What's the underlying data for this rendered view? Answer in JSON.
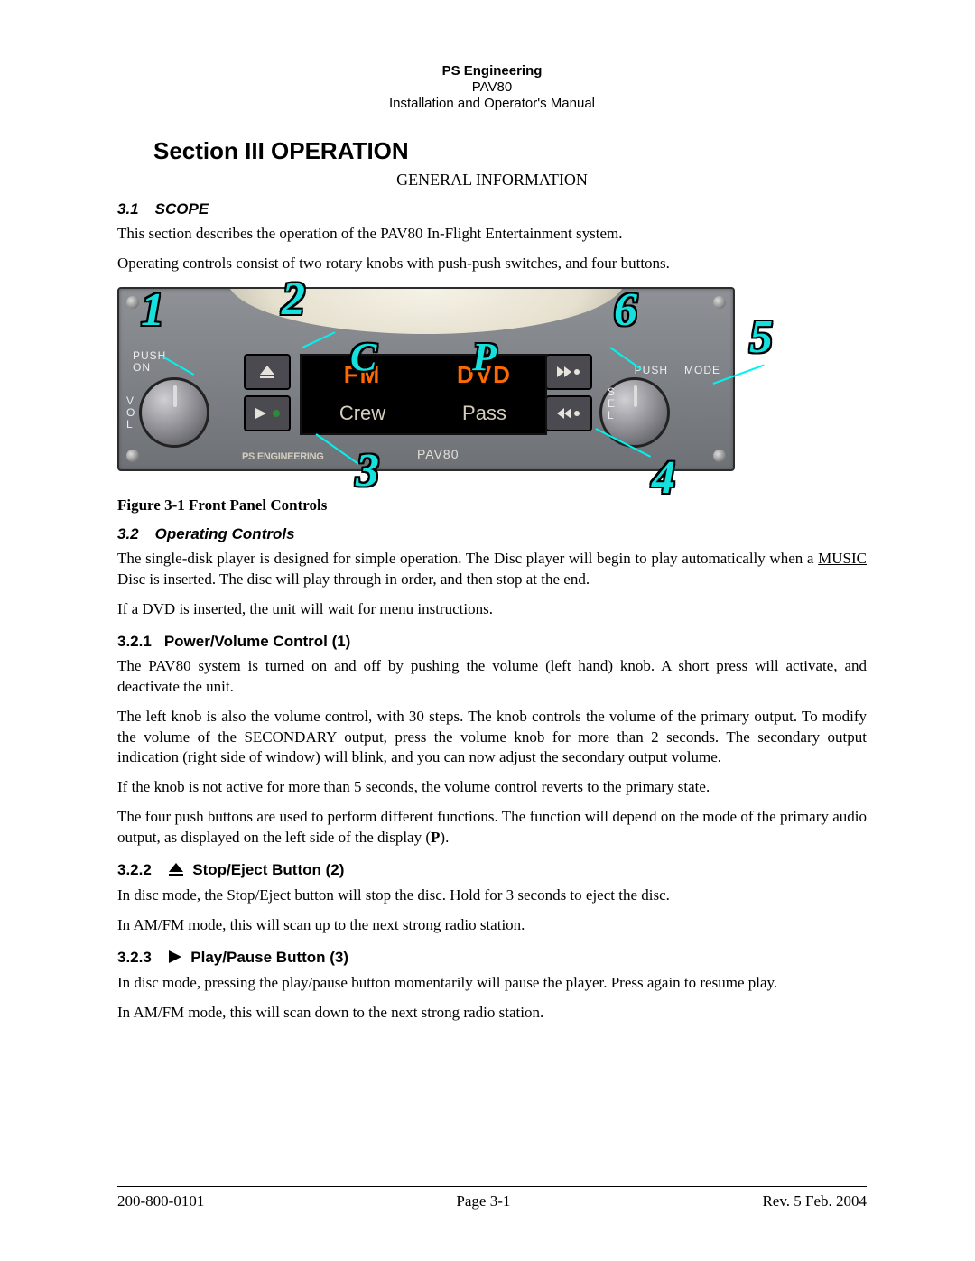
{
  "header": {
    "company": "PS Engineering",
    "product": "PAV80",
    "manual": "Installation and Operator's Manual"
  },
  "title": "Section III OPERATION",
  "subtitle": "GENERAL INFORMATION",
  "s31": {
    "num": "3.1",
    "name": "SCOPE"
  },
  "p_scope1": "This section describes the operation of the PAV80 In-Flight Entertainment system.",
  "p_scope2": "Operating controls consist of two rotary knobs with push-push switches, and four buttons.",
  "figure": {
    "caption": "Figure 3-1 Front Panel Controls",
    "callouts": {
      "c1": "1",
      "c2": "2",
      "c3": "3",
      "c4": "4",
      "c5": "5",
      "c6": "6",
      "cC": "C",
      "cP": "P"
    },
    "panel": {
      "push_on": "PUSH\nON",
      "vol": "V\nO\nL",
      "push": "PUSH",
      "mode": "MODE",
      "sel": "S\nE\nL",
      "fm": "FM",
      "dvd": "DVD",
      "crew": "Crew",
      "pass": "Pass",
      "model": "PAV80",
      "logo": "PS ENGINEERING"
    }
  },
  "s32": {
    "num": "3.2",
    "name": "Operating Controls"
  },
  "p_oc1a": "The single-disk player is designed for simple operation. The Disc player will begin to play automatically when a ",
  "p_oc1_music": "MUSIC",
  "p_oc1b": " Disc is inserted. The disc will play through in order, and then stop at the end.",
  "p_oc2": "If a DVD is inserted, the unit will wait for menu instructions.",
  "s321": {
    "num": "3.2.1",
    "name": "Power/Volume Control (1)"
  },
  "p_pv1": "The PAV80 system is turned on and off by pushing the volume (left hand) knob. A short press will activate, and deactivate the unit.",
  "p_pv2": "The left knob is also the volume control, with 30 steps. The knob controls the volume of the primary output. To modify the volume of the SECONDARY output, press the volume knob for more than 2 seconds. The secondary output indication (right side of window) will blink, and you can now adjust the secondary output volume.",
  "p_pv3": "If the knob is not active for more than 5 seconds, the volume control reverts to the primary state.",
  "p_pv4a": "The four push buttons are used to perform different functions. The function will depend on the mode of the primary audio output, as displayed on the left side of the display (",
  "p_pv4b": "P",
  "p_pv4c": ").",
  "s322": {
    "num": "3.2.2",
    "name": "Stop/Eject Button (2)"
  },
  "p_se1": "In disc mode, the Stop/Eject button will stop the disc. Hold for 3 seconds to eject the disc.",
  "p_se2": "In AM/FM mode, this will scan up to the next strong radio station.",
  "s323": {
    "num": "3.2.3",
    "name": "Play/Pause Button (3)"
  },
  "p_pp1": "In disc mode, pressing the play/pause button momentarily will pause the player. Press again to resume play.",
  "p_pp2": "In AM/FM mode, this will scan down to the next strong radio station.",
  "footer": {
    "docnum": "200-800-0101",
    "page": "Page 3-1",
    "rev": "Rev. 5 Feb. 2004"
  }
}
